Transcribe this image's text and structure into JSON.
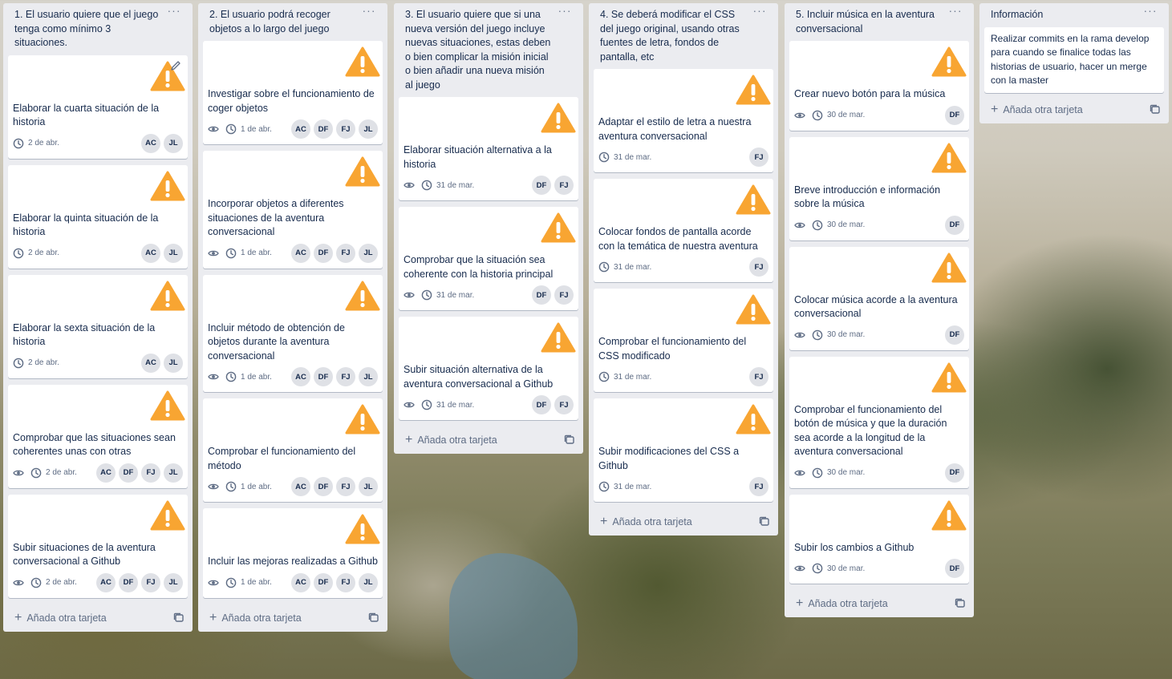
{
  "lists": [
    {
      "title": "1. El usuario quiere que el juego tenga como mínimo 3 situaciones.",
      "add_label": "Añada otra tarjeta",
      "cards": [
        {
          "title": "Elaborar la cuarta situación de la historia",
          "date": "2 de abr.",
          "watch": false,
          "members": [
            "AC",
            "JL"
          ],
          "edit": true
        },
        {
          "title": "Elaborar la quinta situación de la historia",
          "date": "2 de abr.",
          "watch": false,
          "members": [
            "AC",
            "JL"
          ]
        },
        {
          "title": "Elaborar la sexta situación de la historia",
          "date": "2 de abr.",
          "watch": false,
          "members": [
            "AC",
            "JL"
          ]
        },
        {
          "title": "Comprobar que las situaciones sean coherentes unas con otras",
          "date": "2 de abr.",
          "watch": true,
          "members": [
            "AC",
            "DF",
            "FJ",
            "JL"
          ]
        },
        {
          "title": "Subir situaciones de la aventura conversacional a Github",
          "date": "2 de abr.",
          "watch": true,
          "members": [
            "AC",
            "DF",
            "FJ",
            "JL"
          ]
        }
      ]
    },
    {
      "title": "2. El usuario podrá recoger objetos a lo largo del juego",
      "add_label": "Añada otra tarjeta",
      "cards": [
        {
          "title": "Investigar sobre el funcionamiento de coger objetos",
          "date": "1 de abr.",
          "watch": true,
          "members": [
            "AC",
            "DF",
            "FJ",
            "JL"
          ]
        },
        {
          "title": "Incorporar objetos a diferentes situaciones de la aventura conversacional",
          "date": "1 de abr.",
          "watch": true,
          "members": [
            "AC",
            "DF",
            "FJ",
            "JL"
          ]
        },
        {
          "title": "Incluir método de obtención de objetos durante la aventura conversacional",
          "date": "1 de abr.",
          "watch": true,
          "members": [
            "AC",
            "DF",
            "FJ",
            "JL"
          ]
        },
        {
          "title": "Comprobar el funcionamiento del método",
          "date": "1 de abr.",
          "watch": true,
          "members": [
            "AC",
            "DF",
            "FJ",
            "JL"
          ]
        },
        {
          "title": "Incluir las mejoras realizadas a Github",
          "date": "1 de abr.",
          "watch": true,
          "members": [
            "AC",
            "DF",
            "FJ",
            "JL"
          ]
        }
      ]
    },
    {
      "title": "3. El usuario quiere que si una nueva versión del juego incluye nuevas situaciones, estas deben o bien complicar la misión inicial o bien añadir una nueva misión al juego",
      "add_label": "Añada otra tarjeta",
      "cards": [
        {
          "title": "Elaborar situación alternativa a la historia",
          "date": "31 de mar.",
          "watch": true,
          "members": [
            "DF",
            "FJ"
          ]
        },
        {
          "title": "Comprobar que la situación sea coherente con la historia principal",
          "date": "31 de mar.",
          "watch": true,
          "members": [
            "DF",
            "FJ"
          ]
        },
        {
          "title": "Subir situación alternativa de la aventura conversacional a Github",
          "date": "31 de mar.",
          "watch": true,
          "members": [
            "DF",
            "FJ"
          ]
        }
      ]
    },
    {
      "title": "4. Se deberá modificar el CSS del juego original, usando otras fuentes de letra, fondos de pantalla, etc",
      "add_label": "Añada otra tarjeta",
      "cards": [
        {
          "title": "Adaptar el estilo de letra a nuestra aventura conversacional",
          "date": "31 de mar.",
          "watch": false,
          "members": [
            "FJ"
          ]
        },
        {
          "title": "Colocar fondos de pantalla acorde con la temática de nuestra aventura",
          "date": "31 de mar.",
          "watch": false,
          "members": [
            "FJ"
          ]
        },
        {
          "title": "Comprobar el funcionamiento del CSS modificado",
          "date": "31 de mar.",
          "watch": false,
          "members": [
            "FJ"
          ]
        },
        {
          "title": "Subir modificaciones del CSS a Github",
          "date": "31 de mar.",
          "watch": false,
          "members": [
            "FJ"
          ]
        }
      ]
    },
    {
      "title": "5. Incluir música en la aventura conversacional",
      "add_label": "Añada otra tarjeta",
      "cards": [
        {
          "title": "Crear nuevo botón para la música",
          "date": "30 de mar.",
          "watch": true,
          "members": [
            "DF"
          ]
        },
        {
          "title": "Breve introducción e información sobre la música",
          "date": "30 de mar.",
          "watch": true,
          "members": [
            "DF"
          ]
        },
        {
          "title": "Colocar música acorde a la aventura conversacional",
          "date": "30 de mar.",
          "watch": true,
          "members": [
            "DF"
          ]
        },
        {
          "title": "Comprobar el funcionamiento del botón de música y que la duración sea acorde a la longitud de la aventura conversacional",
          "date": "30 de mar.",
          "watch": true,
          "members": [
            "DF"
          ]
        },
        {
          "title": "Subir los cambios a Github",
          "date": "30 de mar.",
          "watch": true,
          "members": [
            "DF"
          ]
        }
      ]
    }
  ],
  "info_list": {
    "title": "Información",
    "text": "Realizar commits en la rama develop para cuando se finalice todas las historias de usuario, hacer un merge con la master",
    "add_label": "Añada otra tarjeta"
  },
  "icons": {
    "cover": "warning-triangle-icon",
    "watch": "eye-icon",
    "due": "clock-icon",
    "menu": "ellipsis-icon",
    "add": "plus-icon",
    "template": "template-icon"
  },
  "colors": {
    "warning": "#f8a532",
    "list_bg": "#ebecf0",
    "avatar_bg": "#dfe1e6"
  }
}
